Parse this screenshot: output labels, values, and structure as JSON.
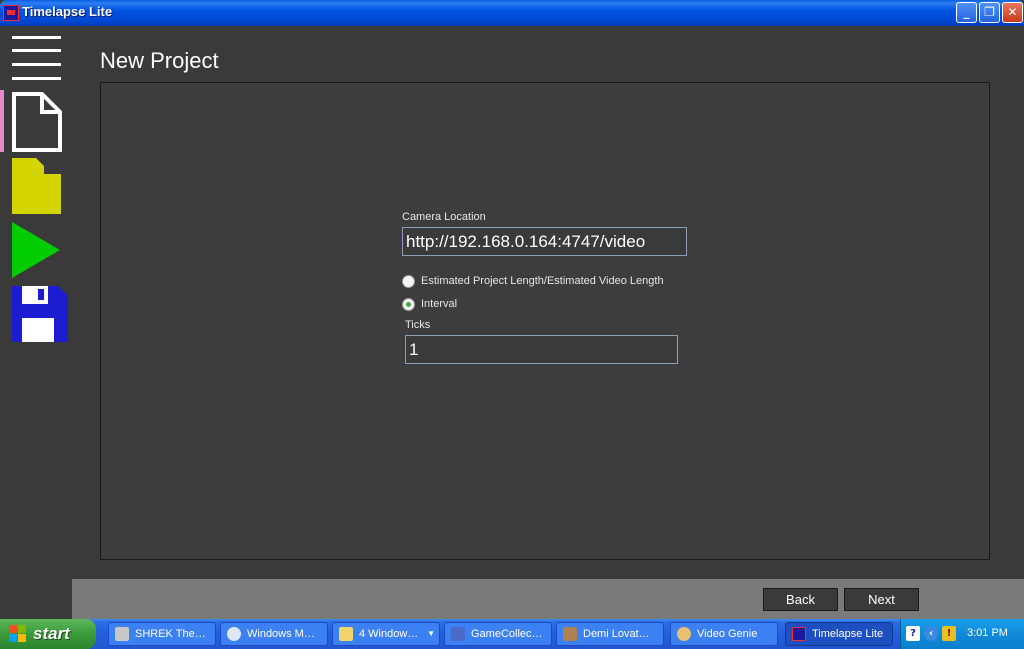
{
  "window": {
    "title": "Timelapse Lite",
    "controls": {
      "minimize": "_",
      "maximize": "❐",
      "close": "✕"
    }
  },
  "sidebar": {
    "items": [
      {
        "name": "menu",
        "icon": "hamburger-menu-icon"
      },
      {
        "name": "new",
        "icon": "new-document-icon",
        "active": true
      },
      {
        "name": "open",
        "icon": "folder-icon",
        "color": "#d4d400"
      },
      {
        "name": "play",
        "icon": "play-icon",
        "color": "#00cc00"
      },
      {
        "name": "save",
        "icon": "floppy-disk-icon",
        "color": "#1c1cd0"
      }
    ],
    "active_marker_color": "#e889c8"
  },
  "page": {
    "title": "New Project",
    "camera_label": "Camera Location",
    "camera_value": "http://192.168.0.164:4747/video",
    "radio_estimated": "Estimated Project Length/Estimated Video Length",
    "radio_interval": "Interval",
    "selected_mode": "Interval",
    "ticks_label": "Ticks",
    "ticks_value": "1"
  },
  "footer": {
    "back_label": "Back",
    "next_label": "Next"
  },
  "taskbar": {
    "start_label": "start",
    "tasks": [
      {
        "label": "SHREK The…",
        "icon": "app-icon"
      },
      {
        "label": "Windows M…",
        "icon": "media-player-icon"
      },
      {
        "label": "4 Window…",
        "icon": "folder-icon"
      },
      {
        "label": "GameCollec…",
        "icon": "gamepad-icon"
      },
      {
        "label": "Demi Lovat…",
        "icon": "app-icon"
      },
      {
        "label": "Video Genie",
        "icon": "paint-icon"
      },
      {
        "label": "Timelapse Lite",
        "icon": "timelapse-icon",
        "active": true
      }
    ],
    "clock": "3:01 PM"
  }
}
